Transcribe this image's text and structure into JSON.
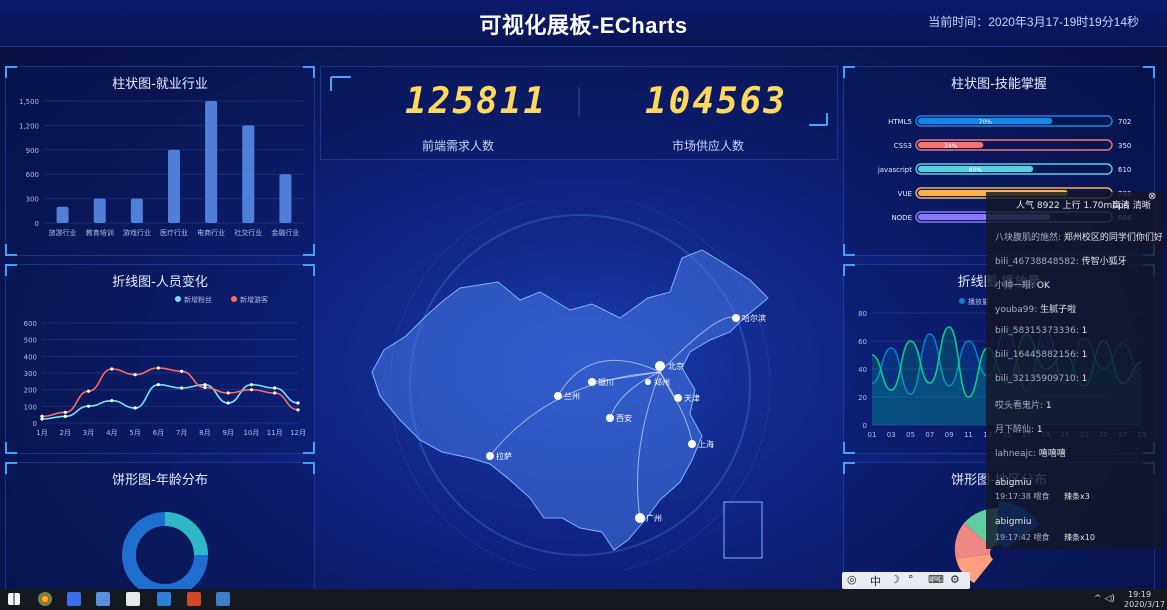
{
  "header": {
    "title": "可视化展板-ECharts",
    "clock": "当前时间：2020年3月17-19时19分14秒"
  },
  "panels": {
    "bar_industry": {
      "title": "柱状图-就业行业"
    },
    "line_people": {
      "title": "折线图-人员变化"
    },
    "pie_age": {
      "title": "饼形图-年龄分布"
    },
    "bar_skill": {
      "title": "柱状图-技能掌握"
    },
    "line_right": {
      "title": "折线图-播放量"
    },
    "pie_region": {
      "title": "饼形图-地区分布"
    }
  },
  "numbers": {
    "demand": {
      "value": "125811",
      "label": "前端需求人数"
    },
    "supply": {
      "value": "104563",
      "label": "市场供应人数"
    }
  },
  "chart_data": [
    {
      "type": "bar",
      "title": "柱状图-就业行业",
      "categories": [
        "旅游行业",
        "教育培训",
        "游戏行业",
        "医疗行业",
        "电商行业",
        "社交行业",
        "金融行业"
      ],
      "values": [
        200,
        300,
        300,
        900,
        1500,
        1200,
        600
      ],
      "ylim": [
        0,
        1500
      ],
      "yticks": [
        "0",
        "300",
        "600",
        "900",
        "1,200",
        "1,500"
      ],
      "color": "#4f7fd9"
    },
    {
      "type": "line",
      "title": "折线图-人员变化",
      "categories": [
        "1月",
        "2月",
        "3月",
        "4月",
        "5月",
        "6月",
        "7月",
        "8月",
        "9月",
        "10月",
        "11月",
        "12月"
      ],
      "series": [
        {
          "name": "新增粉丝",
          "values": [
            24,
            40,
            101,
            134,
            90,
            230,
            210,
            230,
            120,
            230,
            210,
            120
          ],
          "color": "#6fe3ff"
        },
        {
          "name": "新增游客",
          "values": [
            40,
            64,
            191,
            324,
            290,
            330,
            310,
            213,
            180,
            200,
            180,
            79
          ],
          "color": "#ff6a63"
        }
      ],
      "ylim": [
        0,
        600
      ],
      "yticks": [
        "0",
        "100",
        "200",
        "300",
        "400",
        "500",
        "600"
      ]
    },
    {
      "type": "bar",
      "title": "柱状图-技能掌握",
      "categories": [
        "HTML5",
        "CSS3",
        "javascript",
        "VUE",
        "NODE"
      ],
      "values": [
        70,
        34,
        60,
        78,
        69
      ],
      "totals": [
        "702",
        "350",
        "610",
        "793",
        "664"
      ],
      "pct_labels": [
        "70%",
        "34%",
        "60%",
        "",
        ""
      ],
      "colors": [
        "#1089e7",
        "#f57474",
        "#56d0e3",
        "#f8b448",
        "#8b78f6"
      ]
    },
    {
      "type": "line",
      "title": "折线图-播放量",
      "x": [
        "01",
        "03",
        "05",
        "07",
        "09",
        "11",
        "13",
        "15",
        "17",
        "19",
        "21",
        "23",
        "25",
        "27",
        "29"
      ],
      "ylim": [
        0,
        80
      ],
      "yticks": [
        "0",
        "20",
        "40",
        "60",
        "80"
      ],
      "series": [
        {
          "name": "播放量",
          "values": [
            30,
            55,
            22,
            65,
            28,
            60,
            35,
            70,
            25,
            68,
            30,
            62,
            40,
            58,
            35
          ],
          "color": "#0184d5"
        },
        {
          "name": "",
          "values": [
            50,
            25,
            60,
            30,
            70,
            20,
            55,
            30,
            65,
            40,
            50,
            28,
            60,
            30,
            45
          ],
          "color": "#00d887"
        }
      ]
    }
  ],
  "map": {
    "cities": [
      "哈尔滨",
      "北京",
      "天津",
      "银川",
      "兰州",
      "西安",
      "郑州",
      "上海",
      "拉萨",
      "广州"
    ]
  },
  "chat": {
    "stats": "人气 8922   上行 1.70mbps",
    "sub": "高清  清晰",
    "messages": [
      {
        "user": "八块腹肌的施然:",
        "text": "郑州校区的同学们你们好"
      },
      {
        "user": "bili_46738848582:",
        "text": "传智小狐牙"
      },
      {
        "user": "小帅一眼:",
        "text": "OK"
      },
      {
        "user": "youba99:",
        "text": "生腻子啦"
      },
      {
        "user": "bili_58315373336:",
        "text": "1"
      },
      {
        "user": "bili_16445882156:",
        "text": "1"
      },
      {
        "user": "bili_32135909710:",
        "text": "1"
      },
      {
        "user": "哎头看鬼片:",
        "text": "1"
      },
      {
        "user": "月下醉仙:",
        "text": "1"
      },
      {
        "user": "lahneajc:",
        "text": "嘻嘻嘻"
      }
    ],
    "gifts": [
      {
        "user": "abigmiu",
        "time": "19:17:38 喂食",
        "gift": "辣条x3"
      },
      {
        "user": "abigmiu",
        "time": "19:17:42 喂食",
        "gift": "辣条x10"
      }
    ]
  },
  "ime": {
    "mode": "中"
  },
  "taskbar": {
    "time": "19:19",
    "date": "2020/3/17"
  }
}
